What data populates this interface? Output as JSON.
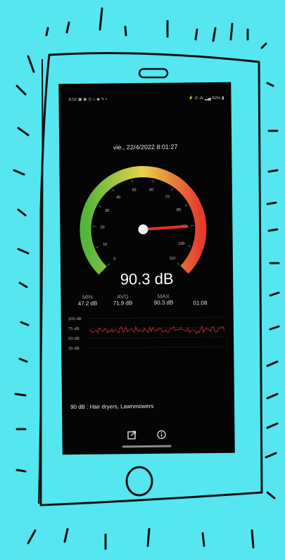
{
  "status_bar": {
    "left_text": "8:02 ▣ ◉ ◷ ⌂ ◆ ✎ •",
    "right_text": "⚡ ✆ ⁂ ▂▄ 82% ▮"
  },
  "datetime": "vie., 22/4/2022 8:01:27",
  "gauge": {
    "min": 0,
    "max": 110,
    "value": 90.3,
    "tick_labels": [
      "0",
      "10",
      "20",
      "30",
      "40",
      "50",
      "60",
      "70",
      "80",
      "90",
      "100",
      "110"
    ],
    "colors": {
      "low": "#52b63a",
      "mid": "#e8d24a",
      "high": "#e53a2c",
      "needle": "#e8322a"
    }
  },
  "reading": "90.3 dB",
  "stats": {
    "min_label": "MIN",
    "min_value": "47.2 dB",
    "avg_label": "AVG",
    "avg_value": "71.9 dB",
    "max_label": "MAX",
    "max_value": "90.3 dB",
    "duration": "01:08"
  },
  "history": {
    "y_labels": [
      "100 dB",
      "75 dB",
      "50 dB",
      "25 dB"
    ],
    "line_color": "#b1262a"
  },
  "info_text": "90 dB : Hair dryers, Lawnmowers",
  "nav": {
    "share_icon": "share-icon",
    "info_icon": "info-icon"
  }
}
